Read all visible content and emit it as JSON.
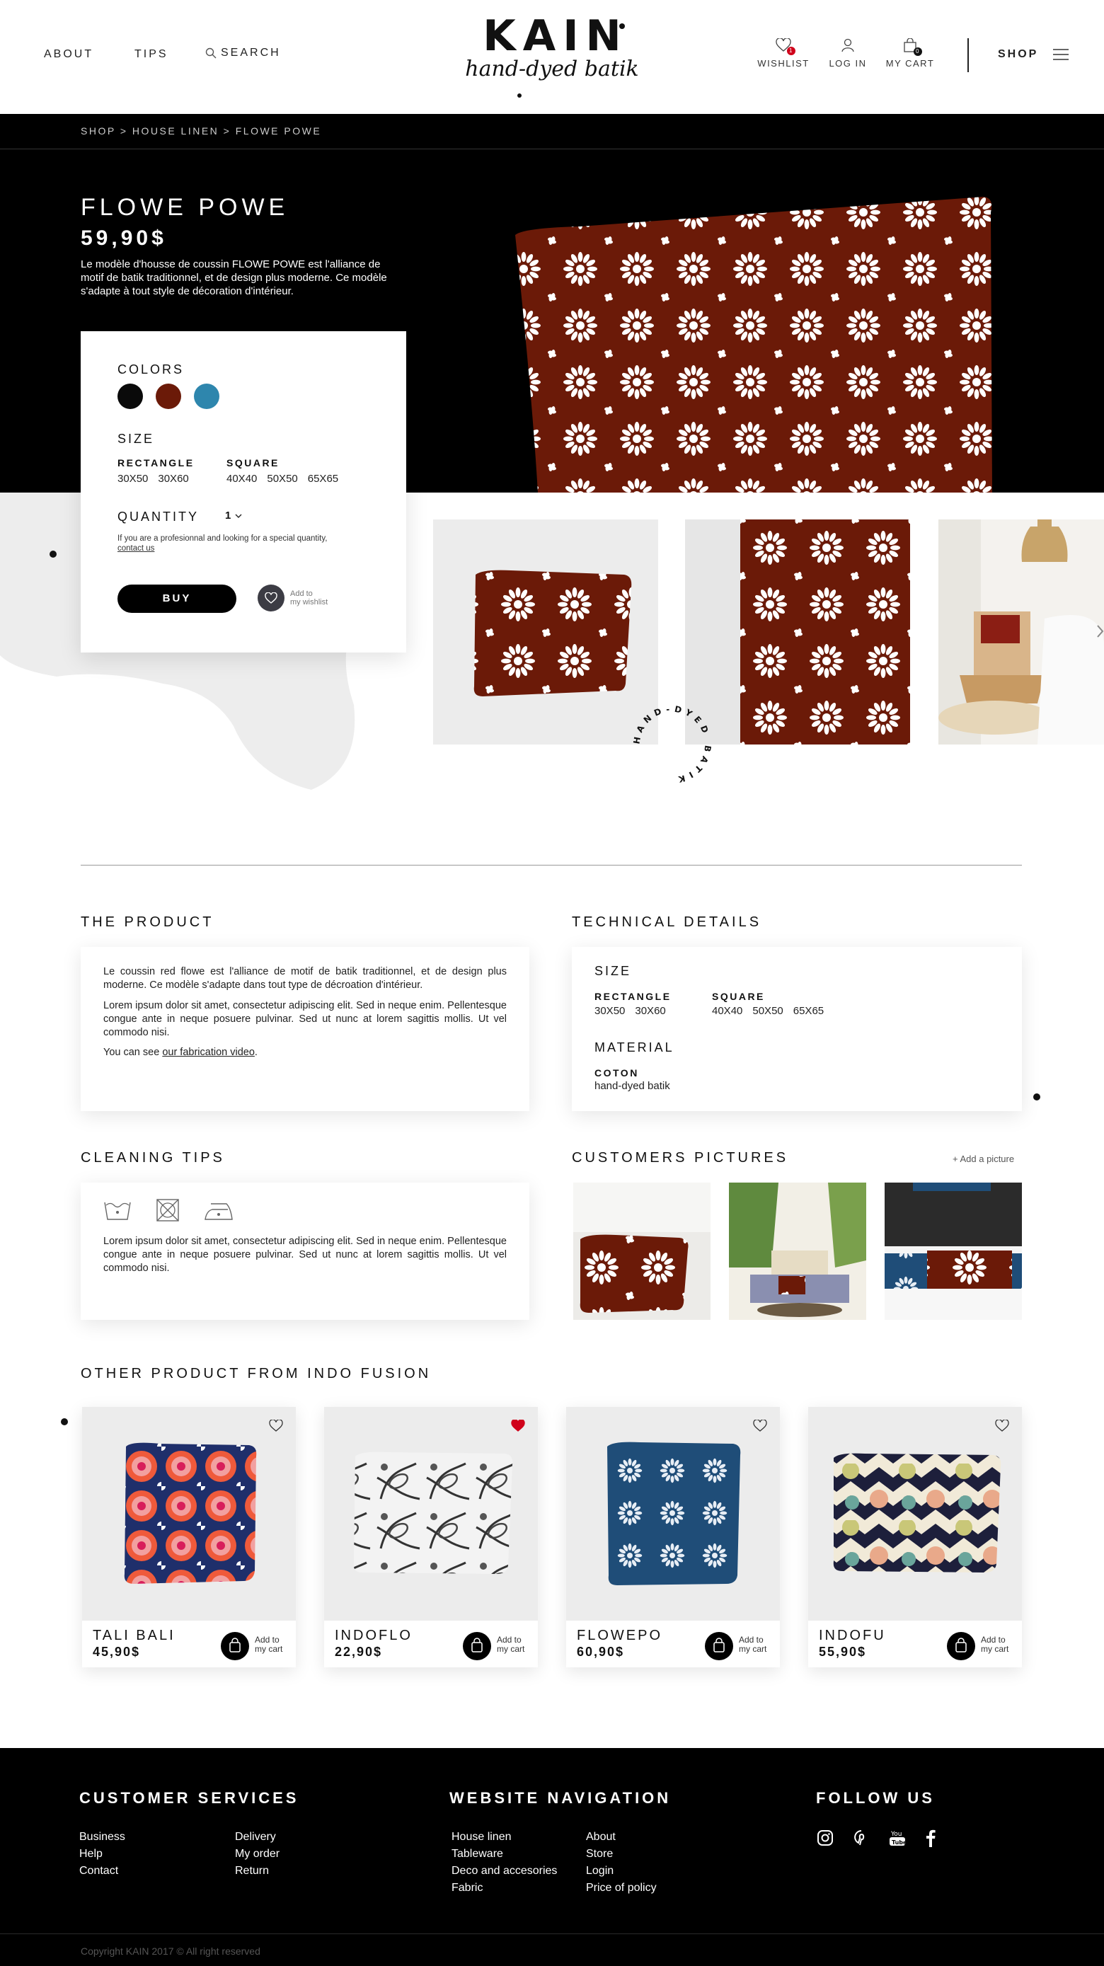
{
  "header": {
    "nav": [
      "ABOUT",
      "TIPS"
    ],
    "search_label": "SEARCH",
    "logo": {
      "word": "KAIN",
      "tagline": "hand-dyed batik"
    },
    "wishlist_label": "WISHLIST",
    "wishlist_count": "1",
    "login_label": "LOG IN",
    "cart_label": "MY CART",
    "cart_count": "0",
    "shop_label": "SHOP"
  },
  "breadcrumb": "SHOP > HOUSE LINEN > FLOWE POWE",
  "product": {
    "title": "FLOWE POWE",
    "price": "59,90$",
    "description": "Le modèle d'housse de coussin FLOWE POWE est l'alliance de motif de batik traditionnel, et de design plus moderne. Ce modèle s'adapte à tout style de décoration d'intérieur.",
    "colors_label": "COLORS",
    "colors": [
      "#0a0a0a",
      "#6b1a08",
      "#2e86ad"
    ],
    "size_label": "SIZE",
    "size_groups": [
      {
        "name": "RECTANGLE",
        "options": [
          "30X50",
          "30X60"
        ]
      },
      {
        "name": "SQUARE",
        "options": [
          "40X40",
          "50X50",
          "65X65"
        ]
      }
    ],
    "quantity_label": "QUANTITY",
    "quantity_value": "1",
    "pro_note": "If you are a profesionnal and looking for a special quantity,",
    "pro_link": "contact us",
    "buy_label": "BUY",
    "wishlist_add": [
      "Add to",
      "my wishlist"
    ],
    "stamp_text": "HAND-DYED BATIK"
  },
  "the_product": {
    "title": "THE PRODUCT",
    "p1": "Le coussin red flowe est l'alliance de motif de batik traditionnel, et de design plus moderne. Ce modèle s'adapte dans tout type de décroation d'intérieur.",
    "p2": "Lorem ipsum dolor sit amet, consectetur adipiscing elit. Sed in neque enim. Pellentesque congue ante in neque posuere pulvinar. Sed ut nunc at lorem sagittis mollis. Ut vel commodo nisi.",
    "p3_prefix": "You can see ",
    "p3_link": "our fabrication video",
    "p3_suffix": "."
  },
  "technical": {
    "title": "TECHNICAL DETAILS",
    "size_label": "SIZE",
    "material_label": "MATERIAL",
    "material_name": "COTON",
    "material_desc": "hand-dyed batik"
  },
  "cleaning": {
    "title": "CLEANING TIPS",
    "text": "Lorem ipsum dolor sit amet, consectetur adipiscing elit. Sed in neque enim. Pellentesque congue ante in neque posuere pulvinar. Sed ut nunc at lorem sagittis mollis. Ut vel commodo nisi."
  },
  "customers": {
    "title": "CUSTOMERS PICTURES",
    "add_label": "+ Add a picture"
  },
  "related": {
    "title": "OTHER PRODUCT FROM INDO FUSION",
    "cart_label": [
      "Add to",
      "my cart"
    ],
    "items": [
      {
        "name": "TALI BALI",
        "price": "45,90$",
        "liked": false
      },
      {
        "name": "INDOFLO",
        "price": "22,90$",
        "liked": true
      },
      {
        "name": "FLOWEPO",
        "price": "60,90$",
        "liked": false
      },
      {
        "name": "INDOFU",
        "price": "55,90$",
        "liked": false
      }
    ]
  },
  "footer": {
    "customer_services": {
      "title": "CUSTOMER SERVICES",
      "col1": [
        "Business",
        "Help",
        "Contact"
      ],
      "col2": [
        "Delivery",
        "My order",
        "Return"
      ]
    },
    "navigation": {
      "title": "WEBSITE NAVIGATION",
      "col1": [
        "House linen",
        "Tableware",
        "Deco and accesories",
        "Fabric"
      ],
      "col2": [
        "About",
        "Store",
        "Login",
        "Price of policy"
      ]
    },
    "follow": {
      "title": "FOLLOW US"
    },
    "copyright": "Copyright KAIN 2017 © All right reserved"
  },
  "colors": {
    "accent_red": "#d0021b",
    "pillow_red": "#6b1a08",
    "pillow_blue": "#1f4d78"
  }
}
